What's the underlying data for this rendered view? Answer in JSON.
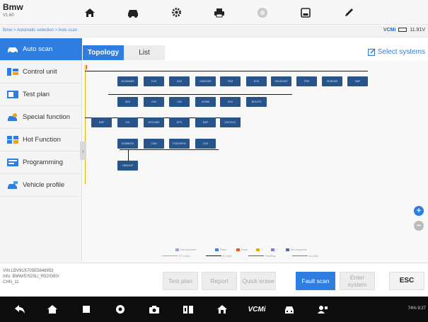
{
  "header": {
    "title": "Bmw",
    "subtitle": "V1.60",
    "toolbar": [
      {
        "name": "home-icon",
        "label": "Home"
      },
      {
        "name": "vehicle-icon",
        "label": "Vehicle"
      },
      {
        "name": "settings-icon",
        "label": "Settings"
      },
      {
        "name": "print-icon",
        "label": "Print"
      },
      {
        "name": "help-icon",
        "label": "Help"
      },
      {
        "name": "save-icon",
        "label": "Save"
      },
      {
        "name": "edit-icon",
        "label": "Edit"
      }
    ]
  },
  "breadcrumb": {
    "text": "Bmw > Automatic selection > Auto scan",
    "vci_label": "VCMi",
    "voltage": "11.91V"
  },
  "sidebar": {
    "items": [
      {
        "label": "Auto scan",
        "active": true
      },
      {
        "label": "Control unit"
      },
      {
        "label": "Test plan"
      },
      {
        "label": "Special function"
      },
      {
        "label": "Hot Function"
      },
      {
        "label": "Programming"
      },
      {
        "label": "Vehicle profile"
      }
    ]
  },
  "tabs": {
    "topology": "Topology",
    "list": "List",
    "select_systems": "Select systems"
  },
  "topology": {
    "row1": [
      "ACSM/ABS",
      "FLM",
      "KAS",
      "DME/DDE",
      "FEM",
      "EGS",
      "HEADUNIT",
      "FRR",
      "SENSOR",
      "SMF"
    ],
    "row2": [
      "SAS",
      "ICM",
      "LIM",
      "KOMBI",
      "EAS",
      "BDC/FE"
    ],
    "row3": [
      "EMF",
      "SZL",
      "DSC/ABS",
      "EPS",
      "EMF",
      "DSC/DXC"
    ],
    "row4": [
      "KOMBI/DA",
      "ZGM",
      "FZD/HKFM",
      "CAS"
    ],
    "row5": [
      "HEADUP"
    ],
    "colors": {
      "node": "#27548a",
      "bus_dark": "#1a1a1a",
      "bus_yellow": "#e0b000",
      "bus_red": "#d22a2a"
    }
  },
  "legend": [
    {
      "label": "Not scanned",
      "color": "#9aa8c8"
    },
    {
      "label": "Pass",
      "color": "#3a7ee0"
    },
    {
      "label": "Fault",
      "color": "#e05a2a"
    },
    {
      "label": "?",
      "color": "#e0b000"
    },
    {
      "label": "?",
      "color": "#7a7ae0"
    },
    {
      "label": "No response",
      "color": "#5a6a8a"
    },
    {
      "label": "PT-CAN",
      "color": "#e0b000"
    },
    {
      "label": "K-CAN",
      "color": "#1a1a1a"
    },
    {
      "label": "FlexRay",
      "color": "#d22a2a"
    },
    {
      "label": "D-CAN",
      "color": "#4a86d8"
    }
  ],
  "vehicle_info": {
    "line1": "VIN:LBV9U5705E5848953",
    "line2": "Info: BMW/5'/525Li_R52/G60/",
    "line3": "CHN_11"
  },
  "actions": {
    "test_plan": "Test plan",
    "report": "Report",
    "quick_erase": "Quick erase",
    "fault_scan": "Fault scan",
    "enter_system": "Enter system",
    "esc": "ESC"
  },
  "navbar": {
    "vcmi": "VCMi",
    "status": "74% 9:27"
  }
}
